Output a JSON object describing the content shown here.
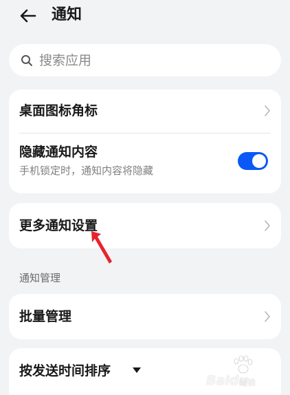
{
  "header": {
    "title": "通知",
    "back_icon": "arrow-left-icon"
  },
  "search": {
    "placeholder": "搜索应用",
    "icon": "search-icon"
  },
  "settings": {
    "badge_row": {
      "label": "桌面图标角标"
    },
    "hide_content_row": {
      "label": "隐藏通知内容",
      "sublabel": "手机锁定时，通知内容将隐藏",
      "toggle_on": true
    },
    "more_row": {
      "label": "更多通知设置"
    }
  },
  "management": {
    "section_label": "通知管理",
    "batch_row": {
      "label": "批量管理"
    },
    "sort_row": {
      "label": "按发送时间排序",
      "icon": "caret-down-icon"
    }
  },
  "annotation": {
    "icon": "red-arrow-icon",
    "color": "#e8232b"
  },
  "watermark": {
    "brand": "Baidu",
    "sub": "经验"
  },
  "colors": {
    "accent": "#0a59f7",
    "background": "#f1f3f5",
    "card": "#ffffff"
  }
}
